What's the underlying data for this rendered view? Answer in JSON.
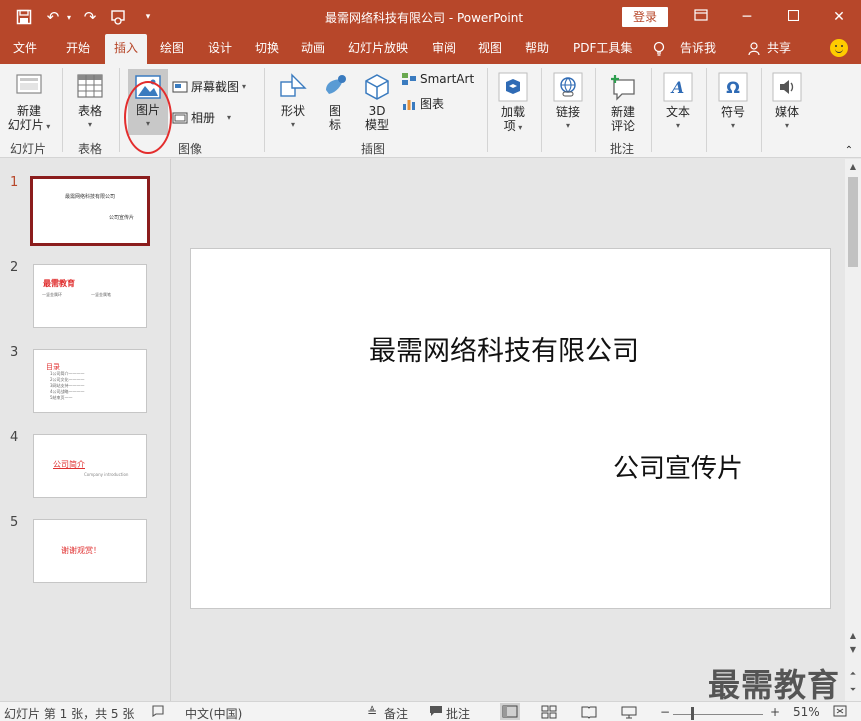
{
  "app": {
    "title": "最需网络科技有限公司  -  PowerPoint",
    "login": "登录"
  },
  "menu": {
    "tabs": [
      "文件",
      "开始",
      "插入",
      "绘图",
      "设计",
      "切换",
      "动画",
      "幻灯片放映",
      "审阅",
      "视图",
      "帮助",
      "PDF工具集",
      "告诉我",
      "共享"
    ]
  },
  "ribbon": {
    "new_slide": [
      "新建",
      "幻灯片"
    ],
    "table": "表格",
    "picture": "图片",
    "screenshot": "屏幕截图",
    "album": "相册",
    "shapes": "形状",
    "icons": [
      "图",
      "标"
    ],
    "model3d": [
      "3D",
      "模型"
    ],
    "smartart": "SmartArt",
    "chart": "图表",
    "addins": [
      "加载",
      "项"
    ],
    "link": "链接",
    "new_comment": [
      "新建",
      "评论"
    ],
    "text": "文本",
    "symbol": "符号",
    "media": "媒体",
    "groups": [
      "幻灯片",
      "表格",
      "图像",
      "插图",
      "批注"
    ]
  },
  "slides": [
    {
      "num": "1",
      "title": "最需网络科技有限公司",
      "sub": "公司宣传片"
    },
    {
      "num": "2",
      "title": "最需教育",
      "left": "一竖金属环",
      "right": "一竖金属笔"
    },
    {
      "num": "3",
      "title": "目录",
      "items": [
        "1公司简介————",
        "2公司文化————",
        "3网站支持————",
        "4公司战略————",
        "5结束页——"
      ]
    },
    {
      "num": "4",
      "title": "公司简介",
      "sub": "Company introduction"
    },
    {
      "num": "5",
      "title": "谢谢观赏！"
    }
  ],
  "main_slide": {
    "title": "最需网络科技有限公司",
    "subtitle": "公司宣传片"
  },
  "watermark": "最需教育",
  "status": {
    "slide_info": "幻灯片 第 1 张，共 5 张",
    "language": "中文(中国)",
    "notes": "备注",
    "comments": "批注",
    "zoom": "51%"
  }
}
